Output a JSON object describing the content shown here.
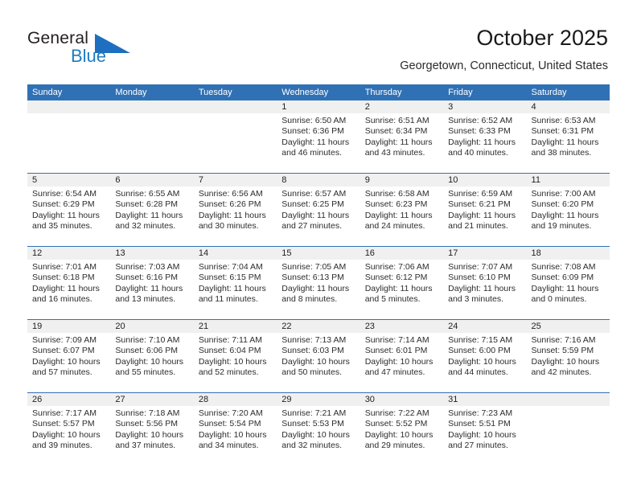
{
  "brand": {
    "name_top": "General",
    "name_bottom": "Blue",
    "triangle_icon": "blue-triangle-icon",
    "color_dark": "#231f20",
    "color_blue": "#1f7bc1"
  },
  "header": {
    "title": "October 2025",
    "subtitle": "Georgetown, Connecticut, United States",
    "accent_color": "#3071b5"
  },
  "calendar": {
    "weekday_headers": [
      "Sunday",
      "Monday",
      "Tuesday",
      "Wednesday",
      "Thursday",
      "Friday",
      "Saturday"
    ],
    "weeks": [
      [
        {
          "day": "",
          "lines": []
        },
        {
          "day": "",
          "lines": []
        },
        {
          "day": "",
          "lines": []
        },
        {
          "day": "1",
          "lines": [
            "Sunrise: 6:50 AM",
            "Sunset: 6:36 PM",
            "Daylight: 11 hours",
            "and 46 minutes."
          ]
        },
        {
          "day": "2",
          "lines": [
            "Sunrise: 6:51 AM",
            "Sunset: 6:34 PM",
            "Daylight: 11 hours",
            "and 43 minutes."
          ]
        },
        {
          "day": "3",
          "lines": [
            "Sunrise: 6:52 AM",
            "Sunset: 6:33 PM",
            "Daylight: 11 hours",
            "and 40 minutes."
          ]
        },
        {
          "day": "4",
          "lines": [
            "Sunrise: 6:53 AM",
            "Sunset: 6:31 PM",
            "Daylight: 11 hours",
            "and 38 minutes."
          ]
        }
      ],
      [
        {
          "day": "5",
          "lines": [
            "Sunrise: 6:54 AM",
            "Sunset: 6:29 PM",
            "Daylight: 11 hours",
            "and 35 minutes."
          ]
        },
        {
          "day": "6",
          "lines": [
            "Sunrise: 6:55 AM",
            "Sunset: 6:28 PM",
            "Daylight: 11 hours",
            "and 32 minutes."
          ]
        },
        {
          "day": "7",
          "lines": [
            "Sunrise: 6:56 AM",
            "Sunset: 6:26 PM",
            "Daylight: 11 hours",
            "and 30 minutes."
          ]
        },
        {
          "day": "8",
          "lines": [
            "Sunrise: 6:57 AM",
            "Sunset: 6:25 PM",
            "Daylight: 11 hours",
            "and 27 minutes."
          ]
        },
        {
          "day": "9",
          "lines": [
            "Sunrise: 6:58 AM",
            "Sunset: 6:23 PM",
            "Daylight: 11 hours",
            "and 24 minutes."
          ]
        },
        {
          "day": "10",
          "lines": [
            "Sunrise: 6:59 AM",
            "Sunset: 6:21 PM",
            "Daylight: 11 hours",
            "and 21 minutes."
          ]
        },
        {
          "day": "11",
          "lines": [
            "Sunrise: 7:00 AM",
            "Sunset: 6:20 PM",
            "Daylight: 11 hours",
            "and 19 minutes."
          ]
        }
      ],
      [
        {
          "day": "12",
          "lines": [
            "Sunrise: 7:01 AM",
            "Sunset: 6:18 PM",
            "Daylight: 11 hours",
            "and 16 minutes."
          ]
        },
        {
          "day": "13",
          "lines": [
            "Sunrise: 7:03 AM",
            "Sunset: 6:16 PM",
            "Daylight: 11 hours",
            "and 13 minutes."
          ]
        },
        {
          "day": "14",
          "lines": [
            "Sunrise: 7:04 AM",
            "Sunset: 6:15 PM",
            "Daylight: 11 hours",
            "and 11 minutes."
          ]
        },
        {
          "day": "15",
          "lines": [
            "Sunrise: 7:05 AM",
            "Sunset: 6:13 PM",
            "Daylight: 11 hours",
            "and 8 minutes."
          ]
        },
        {
          "day": "16",
          "lines": [
            "Sunrise: 7:06 AM",
            "Sunset: 6:12 PM",
            "Daylight: 11 hours",
            "and 5 minutes."
          ]
        },
        {
          "day": "17",
          "lines": [
            "Sunrise: 7:07 AM",
            "Sunset: 6:10 PM",
            "Daylight: 11 hours",
            "and 3 minutes."
          ]
        },
        {
          "day": "18",
          "lines": [
            "Sunrise: 7:08 AM",
            "Sunset: 6:09 PM",
            "Daylight: 11 hours",
            "and 0 minutes."
          ]
        }
      ],
      [
        {
          "day": "19",
          "lines": [
            "Sunrise: 7:09 AM",
            "Sunset: 6:07 PM",
            "Daylight: 10 hours",
            "and 57 minutes."
          ]
        },
        {
          "day": "20",
          "lines": [
            "Sunrise: 7:10 AM",
            "Sunset: 6:06 PM",
            "Daylight: 10 hours",
            "and 55 minutes."
          ]
        },
        {
          "day": "21",
          "lines": [
            "Sunrise: 7:11 AM",
            "Sunset: 6:04 PM",
            "Daylight: 10 hours",
            "and 52 minutes."
          ]
        },
        {
          "day": "22",
          "lines": [
            "Sunrise: 7:13 AM",
            "Sunset: 6:03 PM",
            "Daylight: 10 hours",
            "and 50 minutes."
          ]
        },
        {
          "day": "23",
          "lines": [
            "Sunrise: 7:14 AM",
            "Sunset: 6:01 PM",
            "Daylight: 10 hours",
            "and 47 minutes."
          ]
        },
        {
          "day": "24",
          "lines": [
            "Sunrise: 7:15 AM",
            "Sunset: 6:00 PM",
            "Daylight: 10 hours",
            "and 44 minutes."
          ]
        },
        {
          "day": "25",
          "lines": [
            "Sunrise: 7:16 AM",
            "Sunset: 5:59 PM",
            "Daylight: 10 hours",
            "and 42 minutes."
          ]
        }
      ],
      [
        {
          "day": "26",
          "lines": [
            "Sunrise: 7:17 AM",
            "Sunset: 5:57 PM",
            "Daylight: 10 hours",
            "and 39 minutes."
          ]
        },
        {
          "day": "27",
          "lines": [
            "Sunrise: 7:18 AM",
            "Sunset: 5:56 PM",
            "Daylight: 10 hours",
            "and 37 minutes."
          ]
        },
        {
          "day": "28",
          "lines": [
            "Sunrise: 7:20 AM",
            "Sunset: 5:54 PM",
            "Daylight: 10 hours",
            "and 34 minutes."
          ]
        },
        {
          "day": "29",
          "lines": [
            "Sunrise: 7:21 AM",
            "Sunset: 5:53 PM",
            "Daylight: 10 hours",
            "and 32 minutes."
          ]
        },
        {
          "day": "30",
          "lines": [
            "Sunrise: 7:22 AM",
            "Sunset: 5:52 PM",
            "Daylight: 10 hours",
            "and 29 minutes."
          ]
        },
        {
          "day": "31",
          "lines": [
            "Sunrise: 7:23 AM",
            "Sunset: 5:51 PM",
            "Daylight: 10 hours",
            "and 27 minutes."
          ]
        },
        {
          "day": "",
          "lines": []
        }
      ]
    ]
  }
}
